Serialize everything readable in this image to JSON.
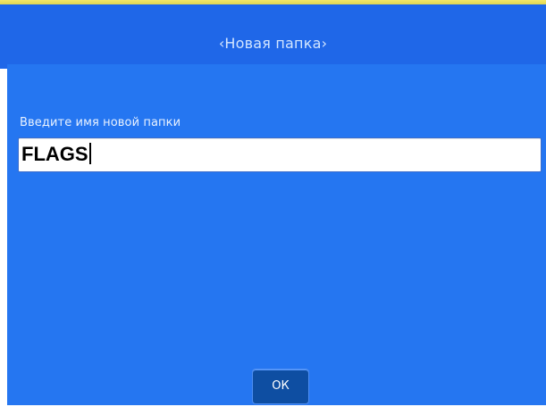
{
  "window": {
    "title": "‹Новая папка›"
  },
  "form": {
    "prompt_label": "Введите имя новой папки",
    "folder_name_value": "FLAGS"
  },
  "actions": {
    "ok_label": "ОК"
  },
  "colors": {
    "header_blue": "#1f67e8",
    "content_blue": "#2576f1",
    "button_blue": "#0e4ea2",
    "input_background": "#ffffff"
  }
}
